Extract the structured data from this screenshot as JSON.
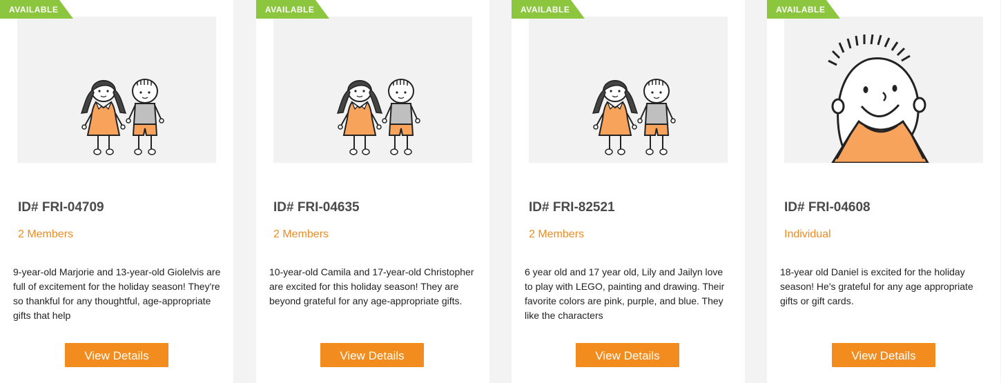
{
  "colors": {
    "badge_green": "#8cc63f",
    "accent_orange": "#f28c1f",
    "members_orange": "#ef8b22",
    "page_background": "#f3f3f3",
    "photo_background": "#f2f2f2"
  },
  "cards": [
    {
      "status": "AVAILABLE",
      "id": "ID# FRI-04709",
      "members": "2 Members",
      "description": "9-year-old Marjorie and 13-year-old Giolelvis are full of excitement for the holiday season! They're so thankful for any thoughtful, age-appropriate gifts that help",
      "button": "View Details",
      "illustration": "girl-and-boy-illustration"
    },
    {
      "status": "AVAILABLE",
      "id": "ID# FRI-04635",
      "members": "2 Members",
      "description": "10-year-old Camila and 17-year-old Christopher are excited for this holiday season! They are beyond grateful for any age-appropriate gifts.",
      "button": "View Details",
      "illustration": "girl-and-boy-illustration"
    },
    {
      "status": "AVAILABLE",
      "id": "ID# FRI-82521",
      "members": "2 Members",
      "description": "6 year old and 17 year old, Lily and Jailyn love to play with LEGO, painting and drawing. Their favorite colors are pink, purple, and blue. They like the characters",
      "button": "View Details",
      "illustration": "girl-and-boy-illustration"
    },
    {
      "status": "AVAILABLE",
      "id": "ID# FRI-04608",
      "members": "Individual",
      "description": "18-year old Daniel is excited for the holiday season! He's grateful for any age appropriate gifts or gift cards.",
      "button": "View Details",
      "illustration": "single-boy-illustration"
    }
  ]
}
